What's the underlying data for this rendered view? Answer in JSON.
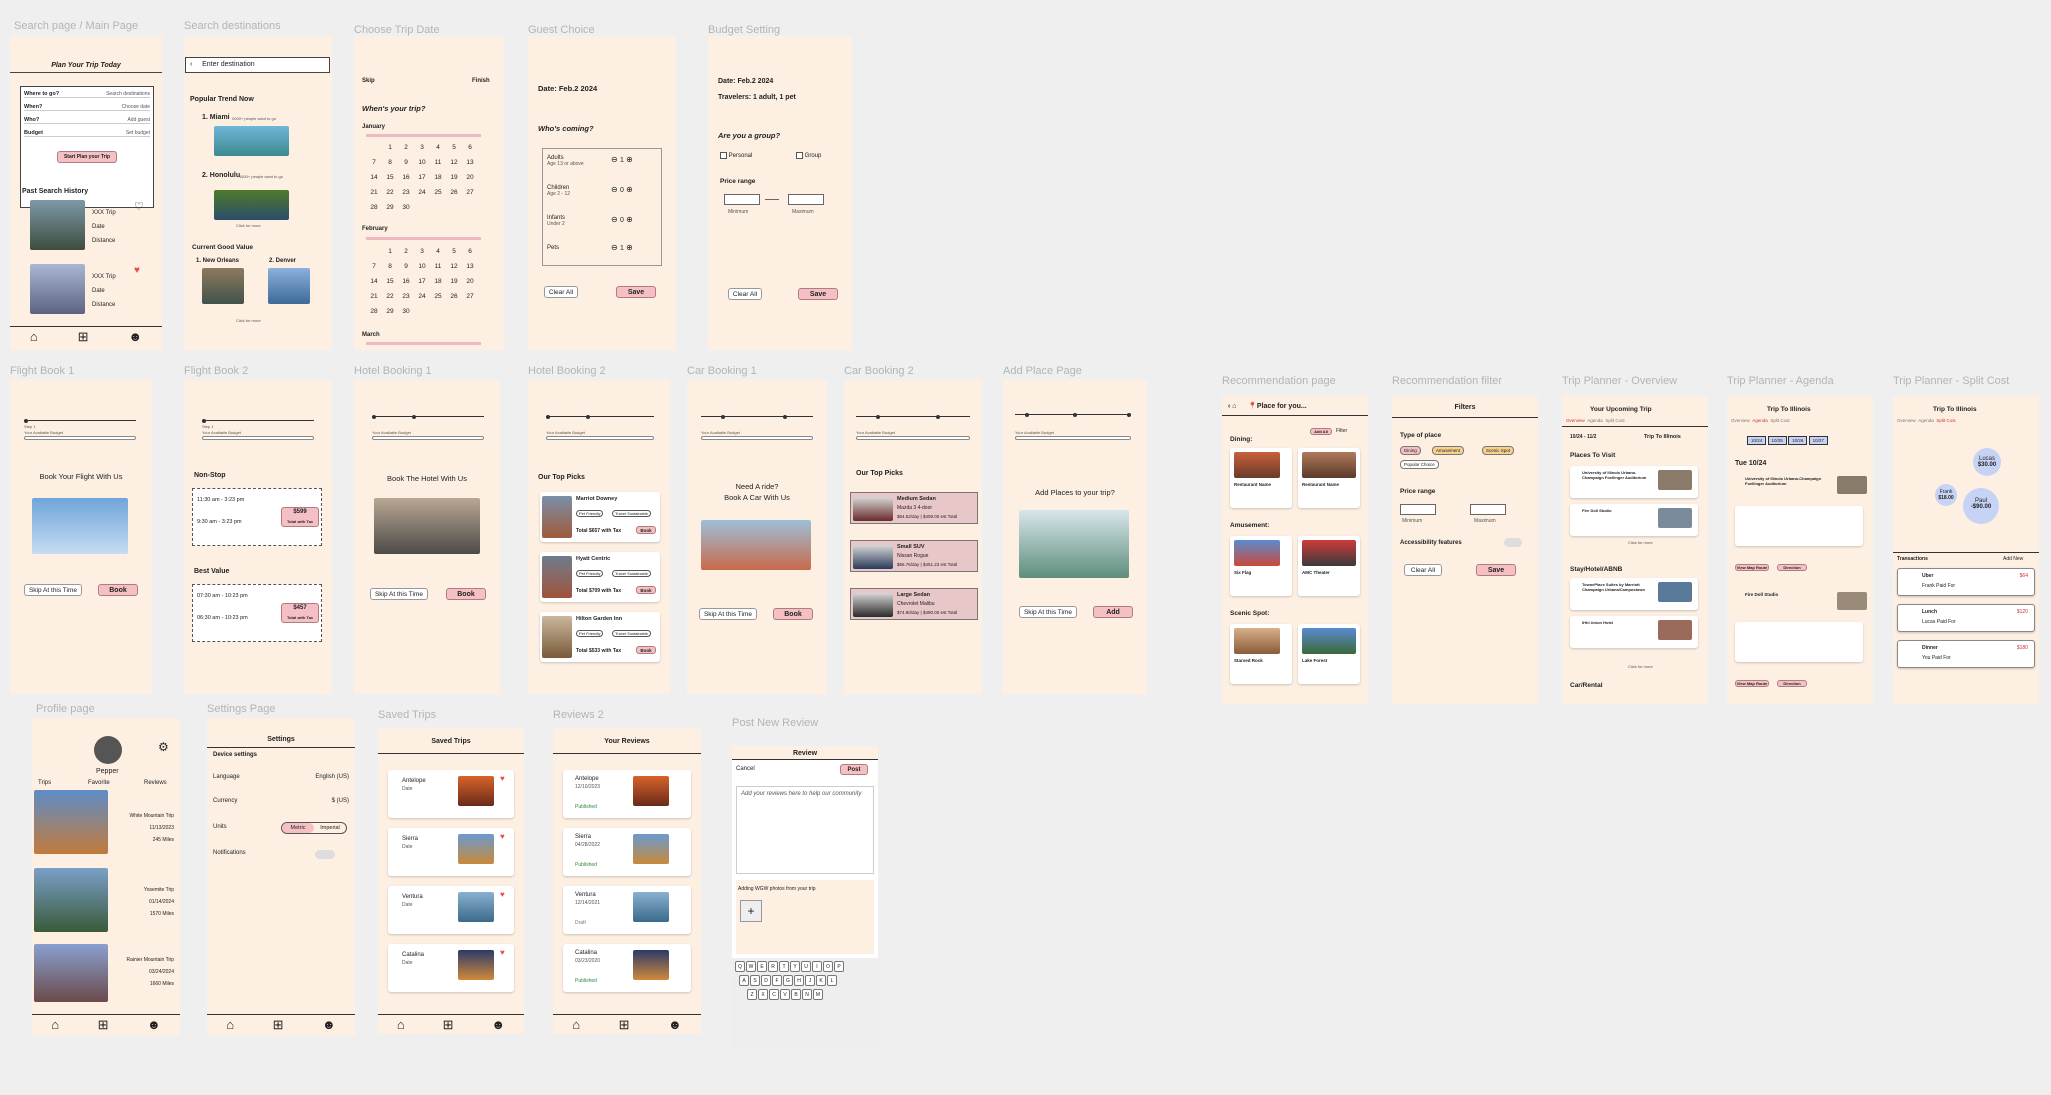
{
  "labels": {
    "search": "Search page / Main Page",
    "dest": "Search destinations",
    "date": "Choose Trip Date",
    "guest": "Guest Choice",
    "budget": "Budget Setting",
    "fb1": "Flight Book 1",
    "fb2": "Flight Book 2",
    "hb1": "Hotel Booking 1",
    "hb2": "Hotel Booking 2",
    "cb1": "Car Booking 1",
    "cb2": "Car Booking 2",
    "ap": "Add Place Page",
    "rec": "Recommendation page",
    "recf": "Recommendation filter",
    "tpo": "Trip Planner - Overview",
    "tpa": "Trip Planner - Agenda",
    "tps": "Trip Planner - Split Cost",
    "prof": "Profile page",
    "set": "Settings Page",
    "saved": "Saved Trips",
    "rev": "Reviews 2",
    "post": "Post New Review"
  },
  "search": {
    "title": "Plan Your Trip Today",
    "rows": [
      {
        "l": "Where to go?",
        "r": "Search destinations"
      },
      {
        "l": "When?",
        "r": "Choose date"
      },
      {
        "l": "Who?",
        "r": "Add guest"
      },
      {
        "l": "Budget",
        "r": "Set budget"
      }
    ],
    "cta": "Start Plan your Trip",
    "history": "Past Search History",
    "items": [
      {
        "a": "XXX Trip",
        "b": "Date",
        "c": "Distance"
      },
      {
        "a": "XXX Trip",
        "b": "Date",
        "c": "Distance"
      }
    ]
  },
  "dest": {
    "input": "Enter destination",
    "popular": "Popular Trend Now",
    "p1": "1. Miami",
    "p1s": "2000+ people want to go",
    "p2": "2. Honolulu",
    "p2s": "1500+ people want to go",
    "more": "Click for more",
    "cgv": "Current Good Value",
    "c1": "1. New Orleans",
    "c2": "2. Denver",
    "more2": "Click for more"
  },
  "date": {
    "skip": "Skip",
    "finish": "Finish",
    "q": "When's your trip?",
    "m1": "January",
    "m2": "February",
    "m3": "March",
    "jan": [
      "",
      "1",
      "2",
      "3",
      "4",
      "5",
      "6",
      "7",
      "8",
      "9",
      "10",
      "11",
      "12",
      "13",
      "14",
      "15",
      "16",
      "17",
      "18",
      "19",
      "20",
      "21",
      "22",
      "23",
      "24",
      "25",
      "26",
      "27",
      "28",
      "29",
      "30"
    ],
    "feb": [
      "",
      "1",
      "2",
      "3",
      "4",
      "5",
      "6",
      "7",
      "8",
      "9",
      "10",
      "11",
      "12",
      "13",
      "14",
      "15",
      "16",
      "17",
      "18",
      "19",
      "20",
      "21",
      "22",
      "23",
      "24",
      "25",
      "26",
      "27",
      "28",
      "29",
      "30"
    ]
  },
  "guest": {
    "date": "Date: Feb.2 2024",
    "q": "Who's coming?",
    "rows": [
      {
        "t": "Adults",
        "s": "Age 13 or above",
        "v": "1"
      },
      {
        "t": "Children",
        "s": "Age 2 - 12",
        "v": "0"
      },
      {
        "t": "Infants",
        "s": "Under 2",
        "v": "0"
      },
      {
        "t": "Pets",
        "s": "",
        "v": "1"
      }
    ],
    "clear": "Clear All",
    "save": "Save"
  },
  "budget": {
    "date": "Date: Feb.2 2024",
    "trav": "Travelers: 1 adult, 1 pet",
    "q": "Are you a group?",
    "personal": "Personal",
    "group": "Group",
    "price": "Price range",
    "min": "Minimum",
    "max": "Maximum",
    "clear": "Clear All",
    "save": "Save"
  },
  "fb1": {
    "step": "Step 1",
    "avail": "Your Available Budget",
    "title": "Book Your Flight With Us",
    "skip": "Skip At this Time",
    "book": "Book"
  },
  "fb2": {
    "step": "Step 1",
    "avail": "Your Available Budget",
    "nonstop": "Non-Stop",
    "best": "Best Value",
    "f1a": "11:30 am - 3:23 pm",
    "f1b": "9:30 am - 3:23 pm",
    "p1": "$599",
    "tot": "Total with Tax",
    "f2a": "07:30 am - 10:23 pm",
    "f2b": "06:30 am - 10:23 pm",
    "p2": "$457"
  },
  "hb1": {
    "avail": "Your Available Budget",
    "title": "Book The Hotel With Us",
    "skip": "Skip At this Time",
    "book": "Book"
  },
  "hb2": {
    "avail": "Your Available Budget",
    "picks": "Our Top Picks",
    "hotels": [
      {
        "n": "Marriot Downey",
        "t": "Total $657 with Tax"
      },
      {
        "n": "Hyatt Centric",
        "t": "Total $709 with Tax"
      },
      {
        "n": "Hilton Garden Inn",
        "t": "Total $533 with Tax"
      }
    ],
    "book": "Book",
    "tag1": "Pet Friendly",
    "tag2": "Travel Sustainable"
  },
  "cb1": {
    "avail": "Your Available Budget",
    "t1": "Need A ride?",
    "t2": "Book A Car With Us",
    "skip": "Skip At this Time",
    "book": "Book"
  },
  "cb2": {
    "avail": "Your Available Budget",
    "picks": "Our Top Picks",
    "cars": [
      {
        "n": "Medium Sedan",
        "m": "Mazda 3 4-door",
        "p": "$64.52/day | $409.00 est Total"
      },
      {
        "n": "Small SUV",
        "m": "Nissan Rogue",
        "p": "$66.76/day | $451.23 est Total"
      },
      {
        "n": "Large Sedan",
        "m": "Chevrolet Malibu",
        "p": "$74.90/day | $490.00 est Total"
      }
    ]
  },
  "ap": {
    "avail": "Your Available Budget",
    "title": "Add Places to your trip?",
    "skip": "Skip At this Time",
    "add": "Add"
  },
  "rec": {
    "place": "Place for you...",
    "addall": "Add All",
    "filter": "Filter",
    "dining": "Dining:",
    "amuse": "Amusement:",
    "scenic": "Scenic Spot:",
    "r1": "Restaurant Name",
    "r2": "Restaurant Name",
    "a1": "Six Flag",
    "a2": "AMC Theater",
    "s1": "Starved Rock",
    "s2": "Lake Forest"
  },
  "recf": {
    "title": "Filters",
    "type": "Type of place",
    "tags": [
      "Dining",
      "Amusement",
      "Scenic Spot",
      "Popular Choice"
    ],
    "price": "Price range",
    "min": "Minimum",
    "max": "Maximum",
    "access": "Accessibility features",
    "clear": "Clear All",
    "save": "Save"
  },
  "tpo": {
    "title": "Your Upcoming Trip",
    "tabs": [
      "Overview",
      "Agenda",
      "Split Cost"
    ],
    "range": "10/24 - 11/2",
    "trip": "Trip To Illinois",
    "visit": "Places To Visit",
    "stay": "Stay/Hotel/ABNB",
    "car": "Car/Rental",
    "more": "Click for more",
    "p1": "University of Illinois Urbana-Champaign Foellinger Auditorium",
    "p2": "Fire Doll Studio",
    "h1": "TownePlace Suites by Marriott Champaign Urbana/Campustown",
    "h2": "iHhi Union Hotel"
  },
  "tpa": {
    "title": "Trip To Illinois",
    "tabs": [
      "Overview",
      "Agenda",
      "Split Cost"
    ],
    "dates": [
      "10/24",
      "10/25",
      "10/26",
      "10/27"
    ],
    "day": "Tue 10/24",
    "p1": "University of Illinois Urbana-Champaign Foellinger Auditorium",
    "p2": "Fire Doll Studio",
    "view": "View Map Route",
    "dir": "Direction"
  },
  "tps": {
    "title": "Trip To Illinois",
    "tabs": [
      "Overview",
      "Agenda",
      "Split Cost"
    ],
    "lucas": "Lucas",
    "lucasv": "$30.00",
    "frank": "Frank",
    "frankv": "$18.00",
    "paul": "Paul",
    "paulv": "-$90.00",
    "trans": "Transactions",
    "addnew": "Add New",
    "t": [
      {
        "n": "Uber",
        "p": "Frank Paid For",
        "v": "$64"
      },
      {
        "n": "Lunch",
        "p": "Lucas Paid For",
        "v": "$120"
      },
      {
        "n": "Dinner",
        "p": "You Paid For",
        "v": "$180"
      }
    ]
  },
  "prof": {
    "name": "Pepper",
    "tabs": [
      "Trips",
      "Favorite",
      "Reviews"
    ],
    "trips": [
      {
        "n": "White Mountain Trip",
        "d": "11/13/2023",
        "m": "245 Miles"
      },
      {
        "n": "Yosemite Trip",
        "d": "01/14/2024",
        "m": "1570 Miles"
      },
      {
        "n": "Rainier Mountain Trip",
        "d": "03/24/2024",
        "m": "1660 Miles"
      }
    ]
  },
  "set": {
    "title": "Settings",
    "dev": "Device settings",
    "lang": "Language",
    "langv": "English (US)",
    "cur": "Currency",
    "curv": "$ (US)",
    "units": "Units",
    "metric": "Metric",
    "imperial": "Imperial",
    "notif": "Notifications"
  },
  "saved": {
    "title": "Saved Trips",
    "items": [
      {
        "n": "Antelope",
        "d": "Date"
      },
      {
        "n": "Sierra",
        "d": "Date"
      },
      {
        "n": "Ventura",
        "d": "Date"
      },
      {
        "n": "Catalina",
        "d": "Date"
      }
    ]
  },
  "rev": {
    "title": "Your Reviews",
    "items": [
      {
        "n": "Antelope",
        "d": "12/10/2023",
        "s": "Published"
      },
      {
        "n": "Sierra",
        "d": "04/28/2022",
        "s": "Published"
      },
      {
        "n": "Ventura",
        "d": "12/14/2021",
        "s": "Draft"
      },
      {
        "n": "Catalina",
        "d": "03/23/2020",
        "s": "Published"
      }
    ]
  },
  "post": {
    "title": "Review",
    "cancel": "Cancel",
    "post": "Post",
    "ph": "Add your reviews here to help our community",
    "add": "Adding WGW photos from your trip",
    "k1": "QWERTYUIOP",
    "k2": "ASDFGHJKL",
    "k3": "ZXCVBNM"
  }
}
